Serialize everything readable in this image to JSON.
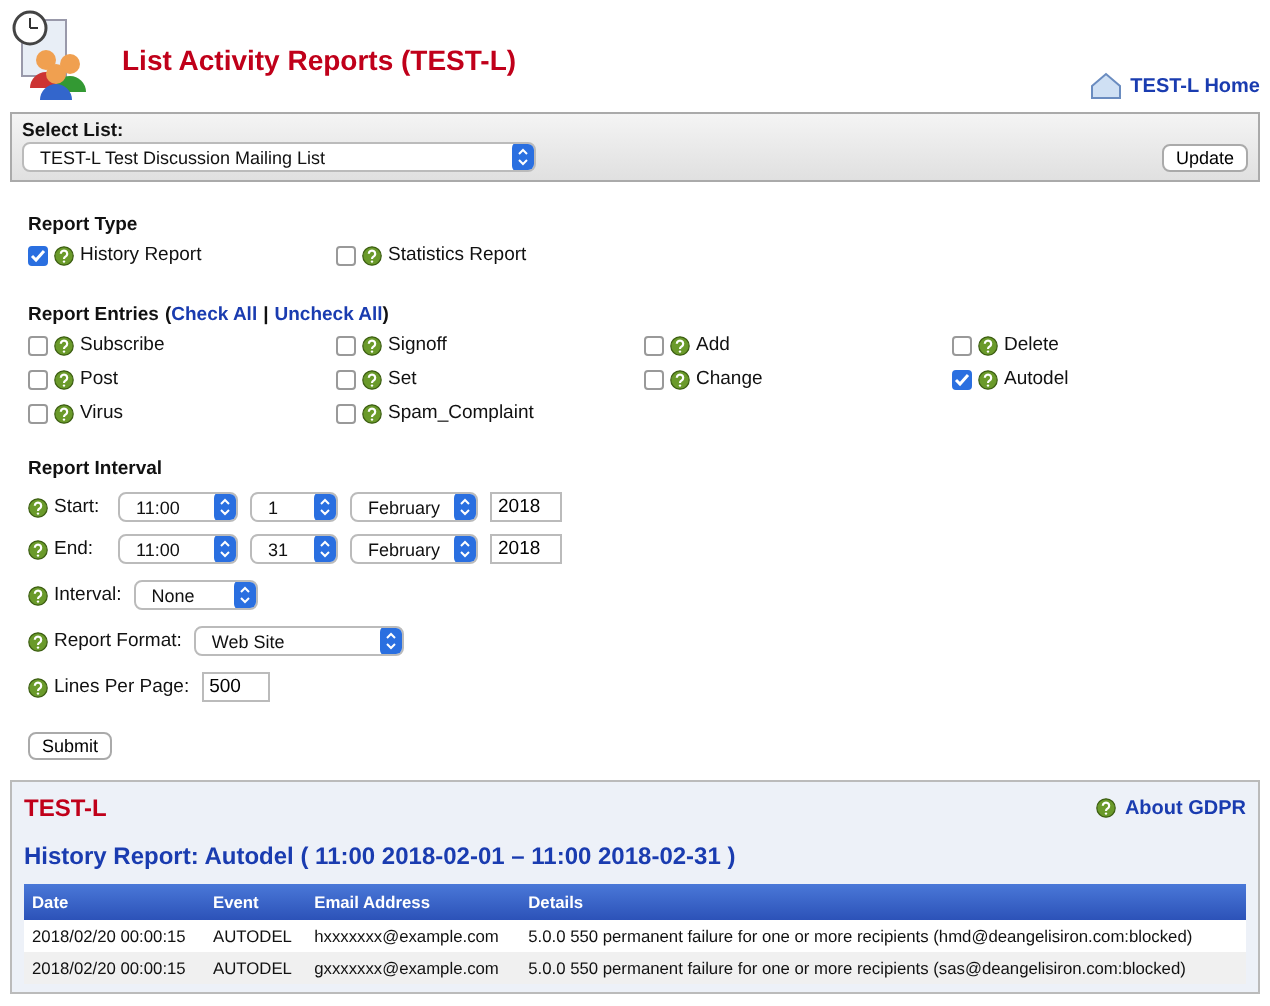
{
  "header": {
    "title": "List Activity Reports (TEST-L)",
    "home_link": "TEST-L Home"
  },
  "select_list": {
    "label": "Select List:",
    "value": "TEST-L Test Discussion Mailing List",
    "button": "Update"
  },
  "report_type": {
    "heading": "Report Type",
    "options": [
      {
        "label": "History Report",
        "checked": true
      },
      {
        "label": "Statistics Report",
        "checked": false
      }
    ]
  },
  "report_entries": {
    "heading": "Report Entries",
    "open_paren": "(",
    "close_paren": ")",
    "check_all": "Check All",
    "separator": "|",
    "uncheck_all": "Uncheck All",
    "options": [
      {
        "label": "Subscribe",
        "checked": false
      },
      {
        "label": "Signoff",
        "checked": false
      },
      {
        "label": "Add",
        "checked": false
      },
      {
        "label": "Delete",
        "checked": false
      },
      {
        "label": "Post",
        "checked": false
      },
      {
        "label": "Set",
        "checked": false
      },
      {
        "label": "Change",
        "checked": false
      },
      {
        "label": "Autodel",
        "checked": true
      },
      {
        "label": "Virus",
        "checked": false
      },
      {
        "label": "Spam_Complaint",
        "checked": false
      }
    ]
  },
  "report_interval": {
    "heading": "Report Interval",
    "start": {
      "label": "Start:",
      "time": "11:00",
      "day": "1",
      "month": "February",
      "year": "2018"
    },
    "end": {
      "label": "End:",
      "time": "11:00",
      "day": "31",
      "month": "February",
      "year": "2018"
    },
    "interval": {
      "label": "Interval:",
      "value": "None"
    },
    "format": {
      "label": "Report Format:",
      "value": "Web Site"
    },
    "lines": {
      "label": "Lines Per Page:",
      "value": "500"
    },
    "submit": "Submit"
  },
  "results": {
    "list_name": "TEST-L",
    "gdpr_link": "About GDPR",
    "title": "History Report: Autodel ( 11:00 2018-02-01 – 11:00 2018-02-31 )",
    "table": {
      "columns": [
        "Date",
        "Event",
        "Email Address",
        "Details"
      ],
      "rows": [
        [
          "2018/02/20 00:00:15",
          "AUTODEL",
          "hxxxxxxx@example.com",
          "5.0.0 550 permanent failure for one or more recipients (hmd@deangelisiron.com:blocked)"
        ],
        [
          "2018/02/20 00:00:15",
          "AUTODEL",
          "gxxxxxxx@example.com",
          "5.0.0 550 permanent failure for one or more recipients (sas@deangelisiron.com:blocked)"
        ]
      ]
    }
  }
}
